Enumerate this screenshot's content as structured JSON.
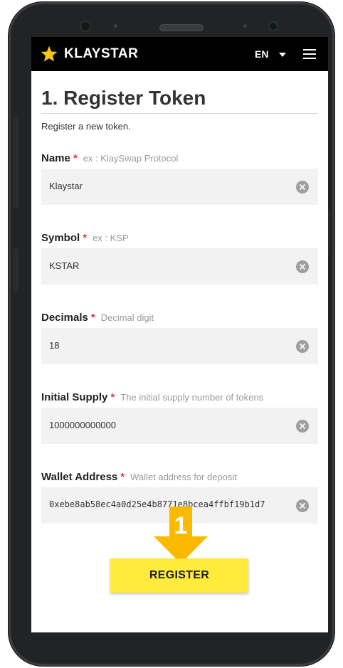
{
  "header": {
    "brand": "KLAYSTAR",
    "language": "EN"
  },
  "page": {
    "title": "1. Register Token",
    "subtitle": "Register a new token."
  },
  "fields": [
    {
      "label": "Name",
      "required": "*",
      "hint": "ex : KlaySwap Protocol",
      "value": "Klaystar"
    },
    {
      "label": "Symbol",
      "required": "*",
      "hint": "ex : KSP",
      "value": "KSTAR"
    },
    {
      "label": "Decimals",
      "required": "*",
      "hint": "Decimal digit",
      "value": "18"
    },
    {
      "label": "Initial Supply",
      "required": "*",
      "hint": "The initial supply number of tokens",
      "value": "1000000000000"
    },
    {
      "label": "Wallet Address",
      "required": "*",
      "hint": "Wallet address for deposit",
      "value": "0xebe8ab58ec4a0d25e4b8771e8bcea4ffbf19b1d7"
    }
  ],
  "step_marker": "1",
  "register_label": "REGISTER",
  "colors": {
    "accent": "#ffeb3b",
    "arrow": "#fbb900",
    "required": "#e53935",
    "topbar": "#000000"
  },
  "icons": {
    "logo": "star-icon",
    "menu": "hamburger-menu-icon",
    "clear": "clear-circle-x-icon",
    "language_caret": "caret-down-icon"
  }
}
